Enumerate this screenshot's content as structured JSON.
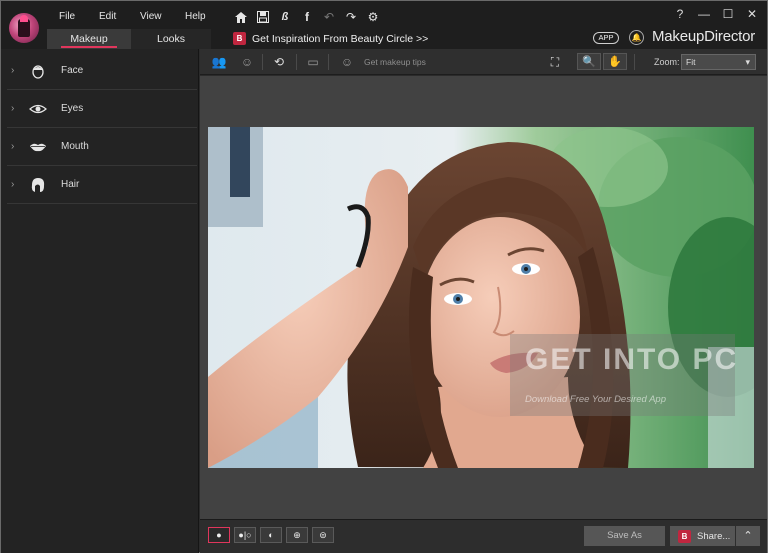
{
  "menu": {
    "file": "File",
    "edit": "Edit",
    "view": "View",
    "help": "Help"
  },
  "tabs": [
    {
      "label": "Makeup",
      "active": true
    },
    {
      "label": "Looks",
      "active": false
    }
  ],
  "toolbar_icons": [
    "home-icon",
    "save-icon",
    "beauty-circle-icon",
    "facebook-icon",
    "undo-icon",
    "redo-icon",
    "settings-icon"
  ],
  "inspiration": {
    "label": "Get Inspiration From Beauty Circle >>",
    "logo_text": "B"
  },
  "window_controls": {
    "help": "?",
    "minimize": "—",
    "maximize": "☐",
    "close": "✕"
  },
  "app_badge": "APP",
  "brand": "MakeupDirector",
  "categories": [
    {
      "label": "Face",
      "icon": "face-icon"
    },
    {
      "label": "Eyes",
      "icon": "eye-icon"
    },
    {
      "label": "Mouth",
      "icon": "lips-icon"
    },
    {
      "label": "Hair",
      "icon": "hair-icon"
    }
  ],
  "subbar": {
    "tips": "Get makeup tips",
    "zoom_label": "Zoom:",
    "zoom_value": "Fit"
  },
  "bottom": {
    "save_as": "Save As",
    "share": "Share..."
  },
  "watermark": {
    "title": "GET INTO PC",
    "subtitle": "Download Free Your Desired App"
  },
  "colors": {
    "accent": "#e0365c",
    "background": "#2b2b2b",
    "canvas": "#424242"
  }
}
